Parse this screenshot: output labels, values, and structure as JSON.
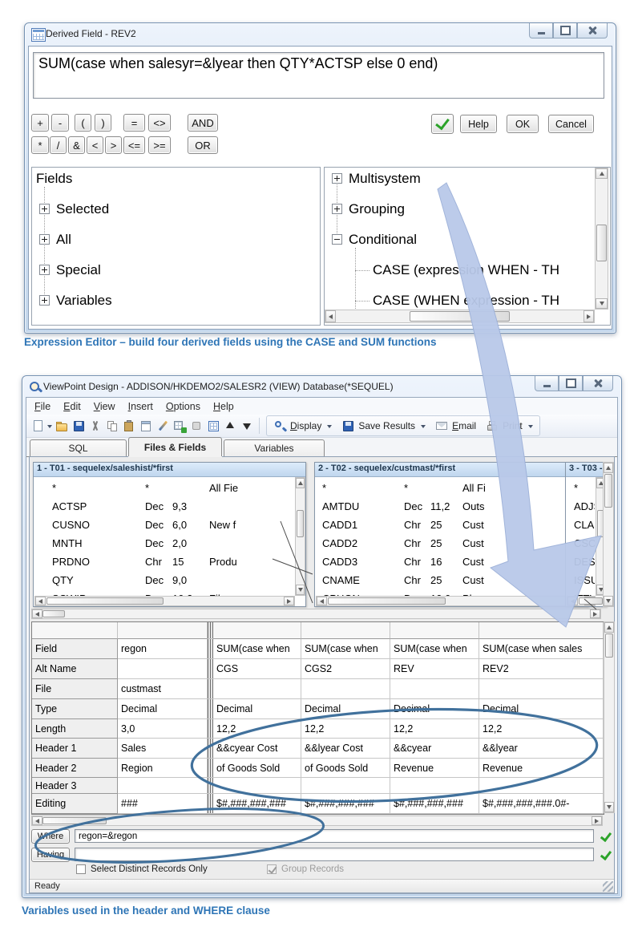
{
  "page": {
    "caption_top": "Expression Editor – build four derived fields using the CASE and SUM functions",
    "caption_bottom": "Variables used in the header and WHERE clause",
    "caption_color": "#2E75B6",
    "annotation_color": "#41719C",
    "arrow_color": "#B9C9E9"
  },
  "expression_dialog": {
    "title": "Derived Field - REV2",
    "expression": "SUM(case when salesyr=&lyear then QTY*ACTSP else 0 end)",
    "operators_row1": [
      "+",
      "-",
      "(",
      ")",
      "=",
      "<>",
      "AND"
    ],
    "operators_row2": [
      "*",
      "/",
      "&",
      "<",
      ">",
      "<=",
      ">=",
      "OR"
    ],
    "validate_icon": "green-check",
    "help_label": "Help",
    "ok_label": "OK",
    "cancel_label": "Cancel",
    "fields_tree": {
      "root": "Fields",
      "items": [
        {
          "label": "Selected",
          "state": "collapsed"
        },
        {
          "label": "All",
          "state": "collapsed"
        },
        {
          "label": "Special",
          "state": "collapsed"
        },
        {
          "label": "Variables",
          "state": "collapsed"
        }
      ]
    },
    "functions_tree": {
      "items": [
        {
          "label": "Multisystem",
          "state": "collapsed"
        },
        {
          "label": "Grouping",
          "state": "collapsed"
        },
        {
          "label": "Conditional",
          "state": "expanded",
          "children": [
            "CASE (expression WHEN - TH",
            "CASE (WHEN expression - TH"
          ]
        }
      ]
    }
  },
  "design_window": {
    "title": "ViewPoint Design - ADDISON/HKDEMO2/SALESR2 (VIEW) Database(*SEQUEL)",
    "menu_items": [
      "File",
      "Edit",
      "View",
      "Insert",
      "Options",
      "Help"
    ],
    "toolbar": {
      "icon_buttons": [
        "new-document",
        "open-folder",
        "save",
        "cut",
        "copy",
        "paste",
        "edit-form",
        "pencil",
        "add-table",
        "format",
        "calculator",
        "move-up",
        "move-down"
      ],
      "labeled_buttons": [
        {
          "icon": "display-magnifier",
          "label": "Display",
          "dropdown": true,
          "underline": true
        },
        {
          "icon": "save-results",
          "label": "Save Results",
          "dropdown": true,
          "underline": false
        },
        {
          "icon": "email-envelope",
          "label": "Email",
          "dropdown": false,
          "underline": true
        },
        {
          "icon": "print",
          "label": "Print",
          "dropdown": true,
          "underline": false
        }
      ]
    },
    "tabs": [
      {
        "label": "SQL",
        "active": false
      },
      {
        "label": "Files & Fields",
        "active": true
      },
      {
        "label": "Variables",
        "active": false
      }
    ],
    "file_panels": [
      {
        "title": "1 - T01 - sequelex/saleshist/*first",
        "rows": [
          {
            "name": "*",
            "type": "*",
            "len": "",
            "desc": "All Fie"
          },
          {
            "name": "ACTSP",
            "type": "Dec",
            "len": "9,3",
            "desc": ""
          },
          {
            "name": "CUSNO",
            "type": "Dec",
            "len": "6,0",
            "desc": "New f"
          },
          {
            "name": "MNTH",
            "type": "Dec",
            "len": "2,0",
            "desc": ""
          },
          {
            "name": "PRDNO",
            "type": "Chr",
            "len": "15",
            "desc": "Produ"
          },
          {
            "name": "QTY",
            "type": "Dec",
            "len": "9,0",
            "desc": ""
          },
          {
            "name": "SCWIP",
            "type": "Dec",
            "len": "10,2",
            "desc": "Fil"
          }
        ]
      },
      {
        "title": "2 - T02 - sequelex/custmast/*first",
        "rows": [
          {
            "name": "*",
            "type": "*",
            "len": "",
            "desc": "All Fi"
          },
          {
            "name": "AMTDU",
            "type": "Dec",
            "len": "11,2",
            "desc": "Outs"
          },
          {
            "name": "CADD1",
            "type": "Chr",
            "len": "25",
            "desc": "Cust"
          },
          {
            "name": "CADD2",
            "type": "Chr",
            "len": "25",
            "desc": "Cust"
          },
          {
            "name": "CADD3",
            "type": "Chr",
            "len": "16",
            "desc": "Cust"
          },
          {
            "name": "CNAME",
            "type": "Chr",
            "len": "25",
            "desc": "Cust"
          },
          {
            "name": "CPHON",
            "type": "Dec",
            "len": "10,0",
            "desc": "Ph"
          }
        ]
      },
      {
        "title": "3 - T03 -",
        "rows": [
          {
            "name": "*",
            "type": "",
            "len": "",
            "desc": ""
          },
          {
            "name": "ADJS",
            "type": "",
            "len": "",
            "desc": ""
          },
          {
            "name": "CLAS",
            "type": "",
            "len": "",
            "desc": ""
          },
          {
            "name": "CSOI",
            "type": "",
            "len": "",
            "desc": ""
          },
          {
            "name": "DESC",
            "type": "",
            "len": "",
            "desc": ""
          },
          {
            "name": "ISSU",
            "type": "",
            "len": "",
            "desc": ""
          },
          {
            "name": "ITTY",
            "type": "",
            "len": "",
            "desc": ""
          }
        ]
      }
    ],
    "grid": {
      "rows": [
        {
          "label": "Field",
          "cells": [
            "regon",
            "SUM(case when",
            "SUM(case when",
            "SUM(case when",
            "SUM(case when sales"
          ]
        },
        {
          "label": "Alt Name",
          "cells": [
            "",
            "CGS",
            "CGS2",
            "REV",
            "REV2"
          ]
        },
        {
          "label": "File",
          "cells": [
            "custmast",
            "",
            "",
            "",
            ""
          ]
        },
        {
          "label": "Type",
          "cells": [
            "Decimal",
            "Decimal",
            "Decimal",
            "Decimal",
            "Decimal"
          ]
        },
        {
          "label": "Length",
          "cells": [
            "3,0",
            "12,2",
            "12,2",
            "12,2",
            "12,2"
          ]
        },
        {
          "label": "Header 1",
          "cells": [
            "Sales",
            "&&cyear Cost",
            "&&lyear Cost",
            "&&cyear",
            "&&lyear"
          ]
        },
        {
          "label": "Header 2",
          "cells": [
            "Region",
            "of Goods Sold",
            "of Goods Sold",
            "Revenue",
            "Revenue"
          ]
        },
        {
          "label": "Header 3",
          "cells": [
            "",
            "",
            "",
            "",
            ""
          ]
        },
        {
          "label": "Editing",
          "cells": [
            "###",
            "$#,###,###,###",
            "$#,###,###,###",
            "$#,###,###,###",
            "$#,###,###,###.0#-"
          ]
        }
      ]
    },
    "where_label": "Where",
    "where_value": "regon=&regon",
    "having_label": "Having",
    "having_value": "",
    "checkboxes": [
      {
        "label": "Select Distinct Records Only",
        "checked": false,
        "disabled": false
      },
      {
        "label": "Group Records",
        "checked": true,
        "disabled": true
      }
    ],
    "status": "Ready"
  }
}
